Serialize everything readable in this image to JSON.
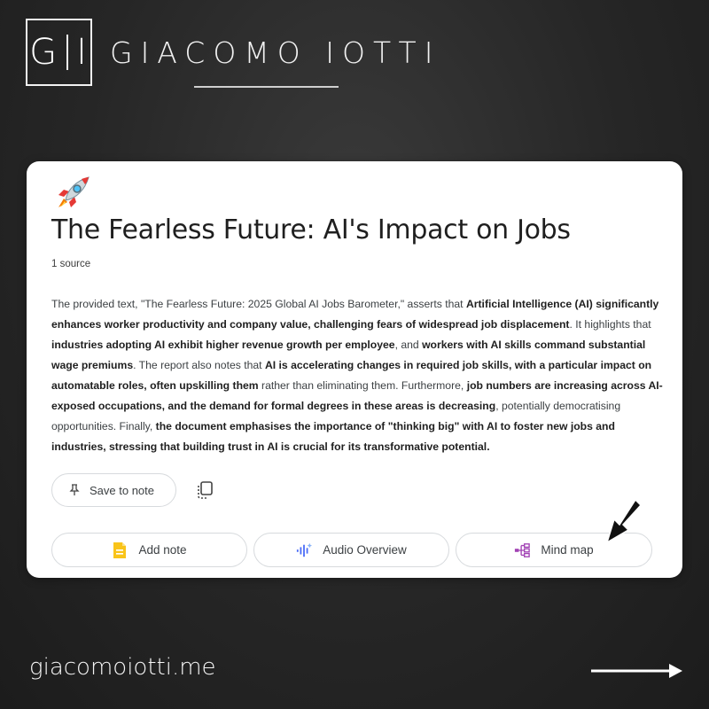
{
  "brand": {
    "monogram_left": "G",
    "monogram_right": "I",
    "name": "GIACOMO IOTTI",
    "website": "giacomoiotti.me"
  },
  "note": {
    "icon": "rocket-emoji-icon",
    "title": "The Fearless Future: AI's Impact on Jobs",
    "source_count": "1 source",
    "summary_segments": [
      {
        "text": "The provided text, \"The Fearless Future: 2025 Global AI Jobs Barometer,\" asserts that ",
        "bold": false
      },
      {
        "text": "Artificial Intelligence (AI) significantly enhances worker productivity and company value, challenging fears of widespread job displacement",
        "bold": true
      },
      {
        "text": ". It highlights that ",
        "bold": false
      },
      {
        "text": "industries adopting AI exhibit higher revenue growth per employee",
        "bold": true
      },
      {
        "text": ", and ",
        "bold": false
      },
      {
        "text": "workers with AI skills command substantial wage premiums",
        "bold": true
      },
      {
        "text": ". The report also notes that ",
        "bold": false
      },
      {
        "text": "AI is accelerating changes in required job skills, with a particular impact on automatable roles, often upskilling them",
        "bold": true
      },
      {
        "text": " rather than eliminating them. Furthermore, ",
        "bold": false
      },
      {
        "text": "job numbers are increasing across AI-exposed occupations, and the demand for formal degrees in these areas is decreasing",
        "bold": true
      },
      {
        "text": ", potentially democratising opportunities. Finally, ",
        "bold": false
      },
      {
        "text": "the document emphasises the importance of \"thinking big\" with AI to foster new jobs and industries, stressing that building trust in AI is crucial for its transformative potential.",
        "bold": true
      }
    ],
    "save_button": {
      "label": "Save to note",
      "icon": "pin-icon"
    },
    "copy_button": {
      "icon": "copy-icon"
    },
    "actions": [
      {
        "label": "Add note",
        "icon": "note-icon",
        "color": "#f4b400"
      },
      {
        "label": "Audio Overview",
        "icon": "audio-waveform-icon",
        "color": "#4a6cf7"
      },
      {
        "label": "Mind map",
        "icon": "mind-map-icon",
        "color": "#a142b4"
      }
    ]
  },
  "colors": {
    "background": "#262626",
    "card": "#ffffff",
    "text_dark": "#1f1f1f",
    "text_body": "#3c4043"
  }
}
